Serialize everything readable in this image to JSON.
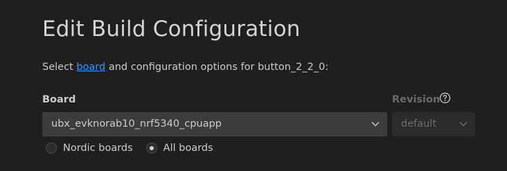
{
  "header": {
    "title": "Edit Build Configuration"
  },
  "subtitle": {
    "prefix": "Select",
    "link": "board",
    "suffix": "and configuration options for button_2_2_0:"
  },
  "board": {
    "label": "Board",
    "selected": "ubx_evknorab10_nrf5340_cpuapp",
    "icon": "chevron-down-icon"
  },
  "revision": {
    "label": "Revision",
    "selected": "default",
    "help_icon": "question-circle-icon",
    "icon": "chevron-down-icon"
  },
  "board_filter": {
    "options": [
      {
        "label": "Nordic boards",
        "checked": false
      },
      {
        "label": "All boards",
        "checked": true
      }
    ]
  },
  "colors": {
    "background": "#1f1f1f",
    "link": "#3794ff",
    "select_bg": "#3c3c3c"
  }
}
